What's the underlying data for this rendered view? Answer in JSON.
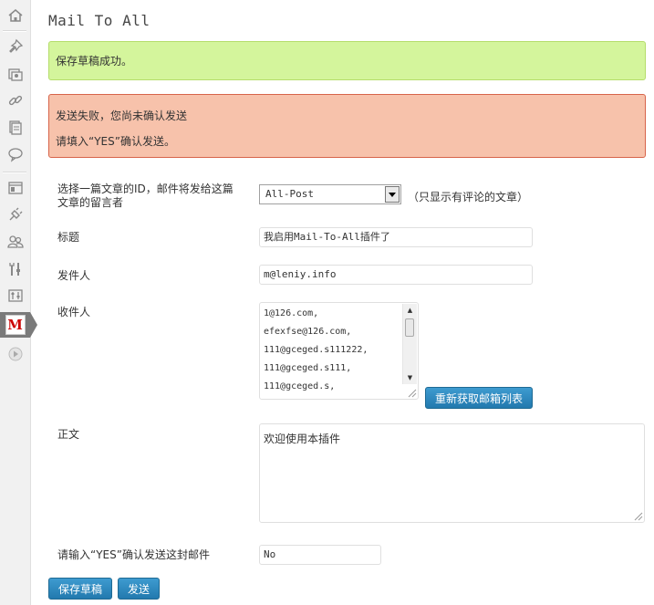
{
  "sidebar": {
    "items": [
      {
        "icon": "home-icon"
      },
      {
        "icon": "pushpin-icon"
      },
      {
        "icon": "media-icon"
      },
      {
        "icon": "links-icon"
      },
      {
        "icon": "pages-icon"
      },
      {
        "icon": "comments-icon"
      },
      {
        "icon": "appearance-icon"
      },
      {
        "icon": "plugins-icon"
      },
      {
        "icon": "users-icon"
      },
      {
        "icon": "tools-icon"
      },
      {
        "icon": "settings-icon"
      },
      {
        "icon": "mail-to-all-icon",
        "logo_text": "M",
        "active": true
      },
      {
        "icon": "collapse-icon"
      }
    ]
  },
  "page": {
    "title": "Mail To All"
  },
  "notices": {
    "success": "保存草稿成功。",
    "error_line1": "发送失败，您尚未确认发送",
    "error_line2": "请填入“YES”确认发送。"
  },
  "form": {
    "post_label": "选择一篇文章的ID，邮件将发给这篇文章的留言者",
    "post_selected": "All-Post",
    "post_hint": "（只显示有评论的文章）",
    "title_label": "标题",
    "title_value": "我启用Mail-To-All插件了",
    "sender_label": "发件人",
    "sender_value": "m@leniy.info",
    "recipients_label": "收件人",
    "recipients_lines": [
      "1@126.com,",
      "efexfse@126.com,",
      "111@gceged.s111222,",
      "111@gceged.s111,",
      "111@gceged.s,"
    ],
    "refresh_button": "重新获取邮箱列表",
    "body_label": "正文",
    "body_value": "欢迎使用本插件",
    "confirm_label": "请输入“YES”确认发送这封邮件",
    "confirm_value": "No"
  },
  "actions": {
    "save_draft": "保存草稿",
    "send": "发送"
  },
  "colors": {
    "success_bg": "#d4f59c",
    "error_bg": "#f7c2ab",
    "button_blue": "#2a82b8"
  }
}
